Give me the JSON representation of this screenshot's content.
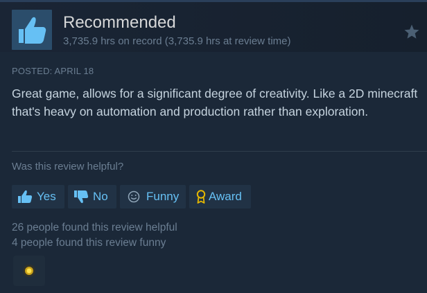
{
  "review": {
    "verdict": "Recommended",
    "hours": "3,735.9 hrs on record (3,735.9 hrs at review time)",
    "posted": "POSTED: APRIL 18",
    "text": "Great game, allows for a significant degree of creativity. Like a 2D minecraft that's heavy on automation and production rather than exploration."
  },
  "helpful": {
    "question": "Was this review helpful?",
    "yes_label": "Yes",
    "no_label": "No",
    "funny_label": "Funny",
    "award_label": "Award"
  },
  "stats": {
    "helpful_text": "26 people found this review helpful",
    "funny_text": "4 people found this review funny"
  },
  "icons": {
    "verdict": "thumbs-up-icon",
    "favorite": "star-icon",
    "yes": "thumbs-up-icon",
    "no": "thumbs-down-icon",
    "funny": "smiley-icon",
    "award": "award-ribbon-icon",
    "received_award": "award-badge-icon"
  },
  "colors": {
    "background": "#1b2838",
    "link": "#66c0f4",
    "text": "#c6d4df",
    "muted": "#6b7e92",
    "award": "#e6b800"
  }
}
